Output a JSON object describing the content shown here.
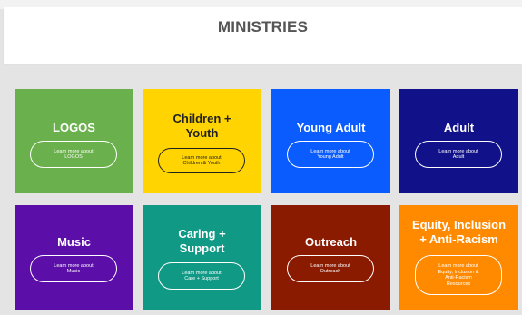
{
  "page": {
    "title": "MINISTRIES"
  },
  "colors": {
    "logos": "#6ab04c",
    "children_youth": "#ffd400",
    "young_adult": "#0a5cff",
    "adult": "#11128a",
    "music": "#5b0fa8",
    "caring_support": "#109a86",
    "outreach": "#8a1a00",
    "equity": "#ff8a00"
  },
  "tiles": [
    {
      "title": "LOGOS",
      "button": "Learn more about\nLOGOS"
    },
    {
      "title": "Children +\nYouth",
      "button": "Learn more about\nChildren & Youth"
    },
    {
      "title": "Young Adult",
      "button": "Learn more about\nYoung Adult"
    },
    {
      "title": "Adult",
      "button": "Learn more about\nAdult"
    },
    {
      "title": "Music",
      "button": "Learn more about\nMusic"
    },
    {
      "title": "Caring +\nSupport",
      "button": "Learn more about\nCare + Support"
    },
    {
      "title": "Outreach",
      "button": "Learn more about\nOutreach"
    },
    {
      "title": "Equity, Inclusion\n+ Anti-Racism",
      "button": "Learn more about\nEquity, Inclusion &\nAnti-Racism\nResources"
    }
  ]
}
